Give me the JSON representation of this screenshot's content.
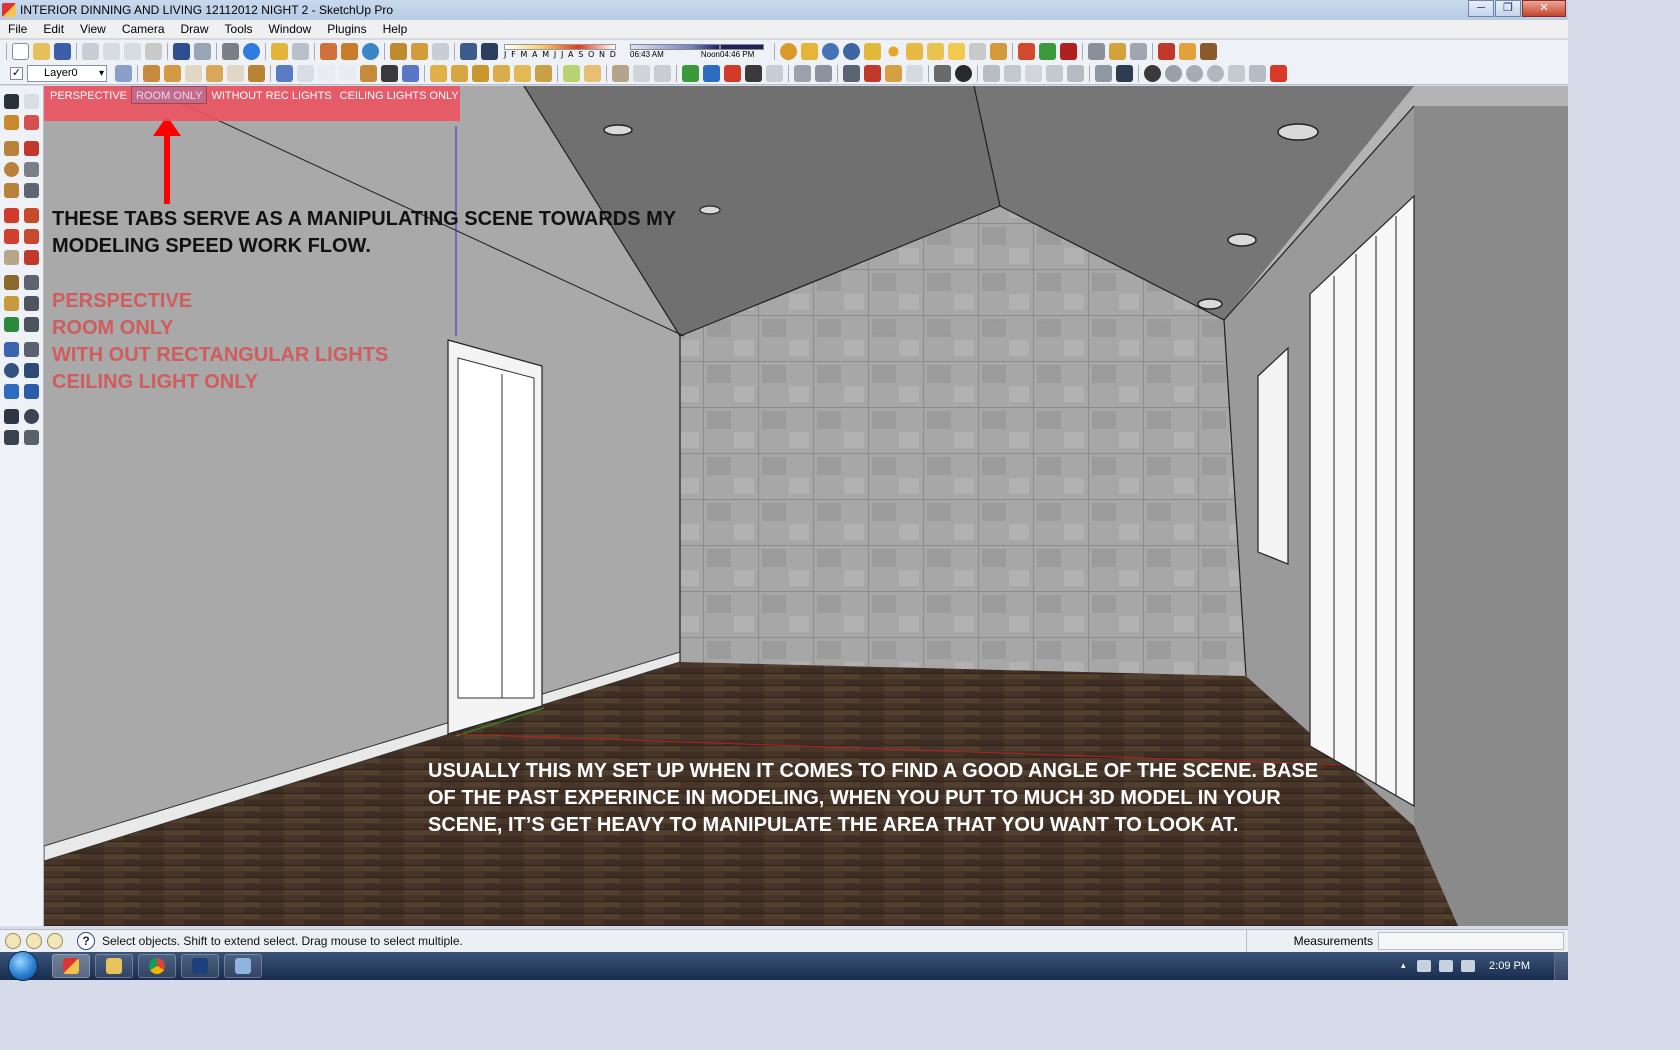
{
  "window": {
    "title": "INTERIOR DINNING AND LIVING 12112012 NIGHT 2 - SketchUp Pro",
    "controls": {
      "minimize": "─",
      "maximize": "❐",
      "close": "✕"
    }
  },
  "menu": [
    "File",
    "Edit",
    "View",
    "Camera",
    "Draw",
    "Tools",
    "Window",
    "Plugins",
    "Help"
  ],
  "shadows_toolbar": {
    "months": [
      "J",
      "F",
      "M",
      "A",
      "M",
      "J",
      "J",
      "A",
      "S",
      "O",
      "N",
      "D"
    ],
    "time_start": "06:43 AM",
    "time_mid": "Noon",
    "time_end": "04:46 PM"
  },
  "layers_toolbar": {
    "check": "✓",
    "current_layer": "Layer0"
  },
  "scene_tabs": [
    {
      "label": "PERSPECTIVE",
      "active": false
    },
    {
      "label": "ROOM ONLY",
      "active": true
    },
    {
      "label": "WITHOUT REC LIGHTS",
      "active": false
    },
    {
      "label": "CEILING LIGHTS ONLY",
      "active": false
    }
  ],
  "annotations": {
    "tabs_note": "THESE TABS SERVE AS A MANIPULATING SCENE TOWARDS MY MODELING SPEED WORK FLOW.",
    "scene_list": [
      "PERSPECTIVE",
      "ROOM ONLY",
      "WITH OUT RECTANGULAR LIGHTS",
      "CEILING LIGHT ONLY"
    ],
    "setup_note": "USUALLY THIS MY SET UP WHEN IT COMES TO FIND A GOOD ANGLE OF THE SCENE. BASE OF THE PAST EXPERINCE IN MODELING, WHEN YOU PUT TO MUCH 3D MODEL IN YOUR SCENE, IT’S GET HEAVY TO MANIPULATE THE AREA THAT YOU WANT TO LOOK AT."
  },
  "status_bar": {
    "help": "?",
    "message": "Select objects. Shift to extend select. Drag mouse to select multiple.",
    "measurements_label": "Measurements",
    "measurements_value": ""
  },
  "taskbar": {
    "clock": "2:09 PM",
    "apps": [
      "sketchup",
      "explorer",
      "chrome",
      "photoshop",
      "window"
    ]
  },
  "colors": {
    "tab_strip": "#ec5260",
    "annotation_red": "#d05c5c",
    "annotation_black": "#111111",
    "annotation_white": "#ffffff",
    "wall_gray": "#b4b4b4",
    "floor_wood": "#4a3728",
    "arrow_red": "#ff0000"
  }
}
